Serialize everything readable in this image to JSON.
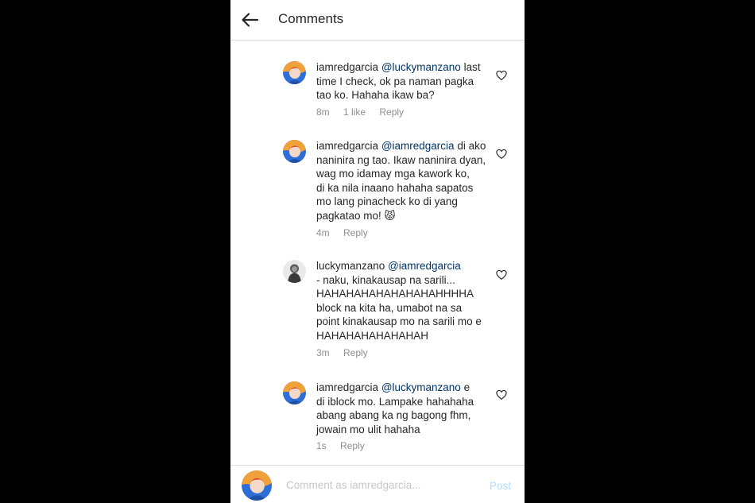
{
  "header": {
    "title": "Comments"
  },
  "comments": [
    {
      "username": "iamredgarcia",
      "mention": "@luckymanzano",
      "lines": [
        " last",
        "time I check, ok pa naman pagka",
        "tao ko. Hahaha ikaw ba?"
      ],
      "time": "8m",
      "likes": "1 like",
      "reply": "Reply",
      "avatar": "red-avatar"
    },
    {
      "username": "iamredgarcia",
      "mention": "@iamredgarcia",
      "lines": [
        " di ako",
        "naninira ng tao. Ikaw naninira dyan,",
        "wag mo idamay mga kawork ko,",
        "di ka nila inaano hahaha sapatos",
        "mo lang pinacheck ko di yang",
        "pagkatao mo! 😾"
      ],
      "time": "4m",
      "likes": "",
      "reply": "Reply",
      "avatar": "red-avatar"
    },
    {
      "username": "luckymanzano",
      "mention": "@iamredgarcia",
      "lines": [
        "",
        "- naku, kinakausap na sarili...",
        "HAHAHAHAHAHAHAHAHHHHA",
        "block na kita ha, umabot na sa",
        "point kinakausap mo na sarili mo e",
        "HAHAHAHAHAHAHAH"
      ],
      "time": "3m",
      "likes": "",
      "reply": "Reply",
      "avatar": "lucky-avatar"
    },
    {
      "username": "iamredgarcia",
      "mention": "@luckymanzano",
      "lines": [
        " e",
        "di iblock mo. Lampake hahahaha",
        "abang abang ka ng bagong fhm,",
        "jowain mo ulit hahaha"
      ],
      "time": "1s",
      "likes": "",
      "reply": "Reply",
      "avatar": "red-avatar"
    }
  ],
  "footer": {
    "placeholder": "Comment as iamredgarcia...",
    "post_label": "Post"
  },
  "colors": {
    "mention": "#003569",
    "meta": "#8e8e8e",
    "post_disabled": "#b3dbff",
    "divider": "#dbdbdb"
  },
  "icons": {
    "back": "arrow-left-icon",
    "like": "heart-outline-icon"
  }
}
